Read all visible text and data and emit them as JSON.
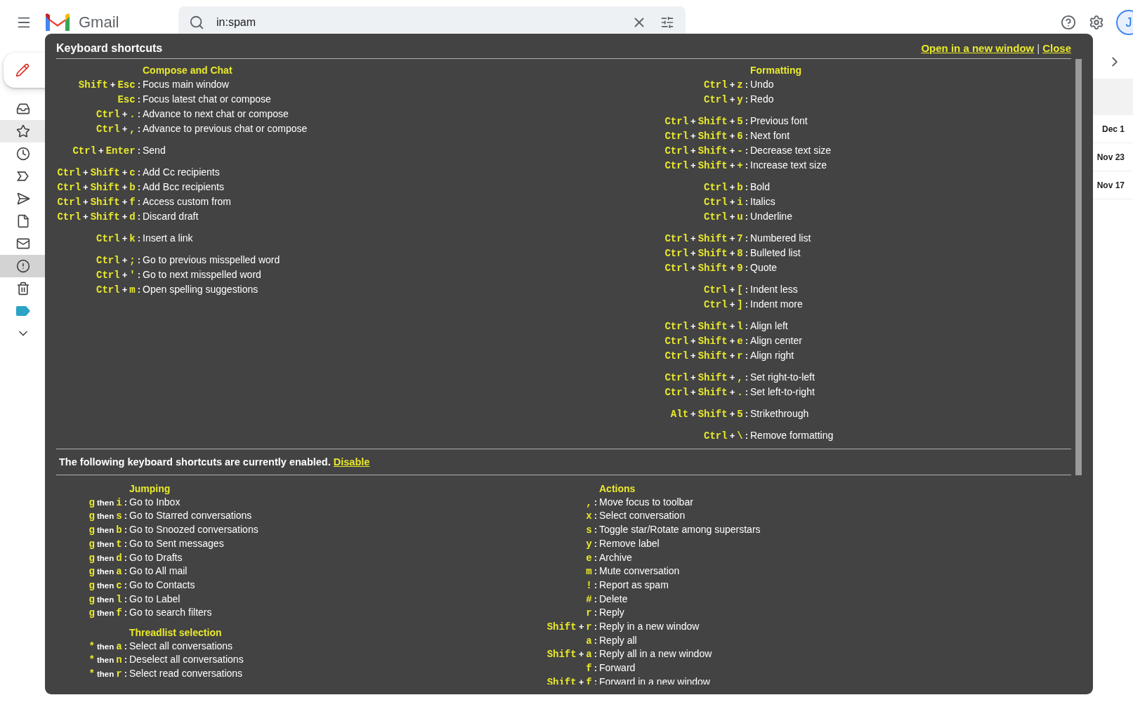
{
  "header": {
    "app_name": "Gmail",
    "search": {
      "value": "in:spam"
    },
    "avatar": "J"
  },
  "sidebar": {
    "items": [
      {
        "selected": false,
        "hovered": false
      },
      {
        "selected": false,
        "hovered": true
      },
      {
        "selected": false,
        "hovered": false
      },
      {
        "selected": false,
        "hovered": false
      },
      {
        "selected": false,
        "hovered": false
      },
      {
        "selected": false,
        "hovered": false
      },
      {
        "selected": false,
        "hovered": false
      },
      {
        "selected": true,
        "hovered": false
      },
      {
        "selected": false,
        "hovered": false
      },
      {
        "selected": false,
        "hovered": false,
        "color": "#2ba3c6"
      },
      {
        "selected": false,
        "hovered": false
      }
    ]
  },
  "messages": [
    {
      "date": "Dec 1"
    },
    {
      "date": "Nov 23"
    },
    {
      "date": "Nov 17"
    }
  ],
  "dialog": {
    "title": "Keyboard shortcuts",
    "links": [
      "Open in a new window",
      "Close"
    ],
    "link_separator": "|",
    "top_sections": [
      {
        "title": "Compose and Chat",
        "groups": [
          [
            {
              "keys": [
                "Shift",
                "+",
                "Esc"
              ],
              "sep": ":",
              "action": "Focus main window"
            },
            {
              "keys": [
                "Esc"
              ],
              "sep": ":",
              "action": "Focus latest chat or compose"
            },
            {
              "keys": [
                "Ctrl",
                "+",
                "."
              ],
              "sep": ":",
              "action": "Advance to next chat or compose"
            },
            {
              "keys": [
                "Ctrl",
                "+",
                ","
              ],
              "sep": ":",
              "action": "Advance to previous chat or compose"
            }
          ],
          [
            {
              "keys": [
                "Ctrl",
                "+",
                "Enter"
              ],
              "sep": ":",
              "action": "Send"
            }
          ],
          [
            {
              "keys": [
                "Ctrl",
                "+",
                "Shift",
                "+",
                "c"
              ],
              "sep": ":",
              "action": "Add Cc recipients"
            },
            {
              "keys": [
                "Ctrl",
                "+",
                "Shift",
                "+",
                "b"
              ],
              "sep": ":",
              "action": "Add Bcc recipients"
            },
            {
              "keys": [
                "Ctrl",
                "+",
                "Shift",
                "+",
                "f"
              ],
              "sep": ":",
              "action": "Access custom from"
            },
            {
              "keys": [
                "Ctrl",
                "+",
                "Shift",
                "+",
                "d"
              ],
              "sep": ":",
              "action": "Discard draft"
            }
          ],
          [
            {
              "keys": [
                "Ctrl",
                "+",
                "k"
              ],
              "sep": ":",
              "action": "Insert a link"
            }
          ],
          [
            {
              "keys": [
                "Ctrl",
                "+",
                ";"
              ],
              "sep": ":",
              "action": "Go to previous misspelled word"
            },
            {
              "keys": [
                "Ctrl",
                "+",
                "'"
              ],
              "sep": ":",
              "action": "Go to next misspelled word"
            },
            {
              "keys": [
                "Ctrl",
                "+",
                "m"
              ],
              "sep": ":",
              "action": "Open spelling suggestions"
            }
          ]
        ]
      },
      {
        "title": "Formatting",
        "groups": [
          [
            {
              "keys": [
                "Ctrl",
                "+",
                "z"
              ],
              "sep": ":",
              "action": "Undo"
            },
            {
              "keys": [
                "Ctrl",
                "+",
                "y"
              ],
              "sep": ":",
              "action": "Redo"
            }
          ],
          [
            {
              "keys": [
                "Ctrl",
                "+",
                "Shift",
                "+",
                "5"
              ],
              "sep": ":",
              "action": "Previous font"
            },
            {
              "keys": [
                "Ctrl",
                "+",
                "Shift",
                "+",
                "6"
              ],
              "sep": ":",
              "action": "Next font"
            },
            {
              "keys": [
                "Ctrl",
                "+",
                "Shift",
                "+",
                "-"
              ],
              "sep": ":",
              "action": "Decrease text size"
            },
            {
              "keys": [
                "Ctrl",
                "+",
                "Shift",
                "+",
                "+"
              ],
              "sep": ":",
              "action": "Increase text size"
            }
          ],
          [
            {
              "keys": [
                "Ctrl",
                "+",
                "b"
              ],
              "sep": ":",
              "action": "Bold"
            },
            {
              "keys": [
                "Ctrl",
                "+",
                "i"
              ],
              "sep": ":",
              "action": "Italics"
            },
            {
              "keys": [
                "Ctrl",
                "+",
                "u"
              ],
              "sep": ":",
              "action": "Underline"
            }
          ],
          [
            {
              "keys": [
                "Ctrl",
                "+",
                "Shift",
                "+",
                "7"
              ],
              "sep": ":",
              "action": "Numbered list"
            },
            {
              "keys": [
                "Ctrl",
                "+",
                "Shift",
                "+",
                "8"
              ],
              "sep": ":",
              "action": "Bulleted list"
            },
            {
              "keys": [
                "Ctrl",
                "+",
                "Shift",
                "+",
                "9"
              ],
              "sep": ":",
              "action": "Quote"
            }
          ],
          [
            {
              "keys": [
                "Ctrl",
                "+",
                "["
              ],
              "sep": ":",
              "action": "Indent less"
            },
            {
              "keys": [
                "Ctrl",
                "+",
                "]"
              ],
              "sep": ":",
              "action": "Indent more"
            }
          ],
          [
            {
              "keys": [
                "Ctrl",
                "+",
                "Shift",
                "+",
                "l"
              ],
              "sep": ":",
              "action": "Align left"
            },
            {
              "keys": [
                "Ctrl",
                "+",
                "Shift",
                "+",
                "e"
              ],
              "sep": ":",
              "action": "Align center"
            },
            {
              "keys": [
                "Ctrl",
                "+",
                "Shift",
                "+",
                "r"
              ],
              "sep": ":",
              "action": "Align right"
            }
          ],
          [
            {
              "keys": [
                "Ctrl",
                "+",
                "Shift",
                "+",
                ","
              ],
              "sep": ":",
              "action": "Set right-to-left"
            },
            {
              "keys": [
                "Ctrl",
                "+",
                "Shift",
                "+",
                "."
              ],
              "sep": ":",
              "action": "Set left-to-right"
            }
          ],
          [
            {
              "keys": [
                "Alt",
                "+",
                "Shift",
                "+",
                "5"
              ],
              "sep": ":",
              "action": "Strikethrough"
            }
          ],
          [
            {
              "keys": [
                "Ctrl",
                "+",
                "\\"
              ],
              "sep": ":",
              "action": "Remove formatting"
            }
          ]
        ]
      }
    ],
    "status": {
      "text": "The following keyboard shortcuts are currently enabled.",
      "link": "Disable"
    },
    "bottom_sections": [
      [
        {
          "title": "Jumping",
          "groups": [
            [
              {
                "keys": [
                  "g",
                  "then",
                  "i"
                ],
                "sep": ":",
                "action": "Go to Inbox"
              },
              {
                "keys": [
                  "g",
                  "then",
                  "s"
                ],
                "sep": ":",
                "action": "Go to Starred conversations"
              },
              {
                "keys": [
                  "g",
                  "then",
                  "b"
                ],
                "sep": ":",
                "action": "Go to Snoozed conversations"
              },
              {
                "keys": [
                  "g",
                  "then",
                  "t"
                ],
                "sep": ":",
                "action": "Go to Sent messages"
              },
              {
                "keys": [
                  "g",
                  "then",
                  "d"
                ],
                "sep": ":",
                "action": "Go to Drafts"
              },
              {
                "keys": [
                  "g",
                  "then",
                  "a"
                ],
                "sep": ":",
                "action": "Go to All mail"
              },
              {
                "keys": [
                  "g",
                  "then",
                  "c"
                ],
                "sep": ":",
                "action": "Go to Contacts"
              },
              {
                "keys": [
                  "g",
                  "then",
                  "l"
                ],
                "sep": ":",
                "action": "Go to Label"
              },
              {
                "keys": [
                  "g",
                  "then",
                  "f"
                ],
                "sep": ":",
                "action": "Go to search filters"
              }
            ]
          ]
        },
        {
          "title": "Threadlist selection",
          "groups": [
            [
              {
                "keys": [
                  "*",
                  "then",
                  "a"
                ],
                "sep": ":",
                "action": "Select all conversations"
              },
              {
                "keys": [
                  "*",
                  "then",
                  "n"
                ],
                "sep": ":",
                "action": "Deselect all conversations"
              },
              {
                "keys": [
                  "*",
                  "then",
                  "r"
                ],
                "sep": ":",
                "action": "Select read conversations"
              }
            ]
          ]
        }
      ],
      [
        {
          "title": "Actions",
          "groups": [
            [
              {
                "keys": [
                  ","
                ],
                "sep": ":",
                "action": "Move focus to toolbar"
              },
              {
                "keys": [
                  "x"
                ],
                "sep": ":",
                "action": "Select conversation"
              },
              {
                "keys": [
                  "s"
                ],
                "sep": ":",
                "action": "Toggle star/Rotate among superstars"
              },
              {
                "keys": [
                  "y"
                ],
                "sep": ":",
                "action": "Remove label"
              },
              {
                "keys": [
                  "e"
                ],
                "sep": ":",
                "action": "Archive"
              },
              {
                "keys": [
                  "m"
                ],
                "sep": ":",
                "action": "Mute conversation"
              },
              {
                "keys": [
                  "!"
                ],
                "sep": ":",
                "action": "Report as spam"
              },
              {
                "keys": [
                  "#"
                ],
                "sep": ":",
                "action": "Delete"
              },
              {
                "keys": [
                  "r"
                ],
                "sep": ":",
                "action": "Reply"
              },
              {
                "keys": [
                  "Shift",
                  "+",
                  "r"
                ],
                "sep": ":",
                "action": "Reply in a new window"
              },
              {
                "keys": [
                  "a"
                ],
                "sep": ":",
                "action": "Reply all"
              },
              {
                "keys": [
                  "Shift",
                  "+",
                  "a"
                ],
                "sep": ":",
                "action": "Reply all in a new window"
              },
              {
                "keys": [
                  "f"
                ],
                "sep": ":",
                "action": "Forward"
              },
              {
                "keys": [
                  "Shift",
                  "+",
                  "f"
                ],
                "sep": ":",
                "action": "Forward in a new window"
              }
            ]
          ]
        }
      ]
    ]
  }
}
